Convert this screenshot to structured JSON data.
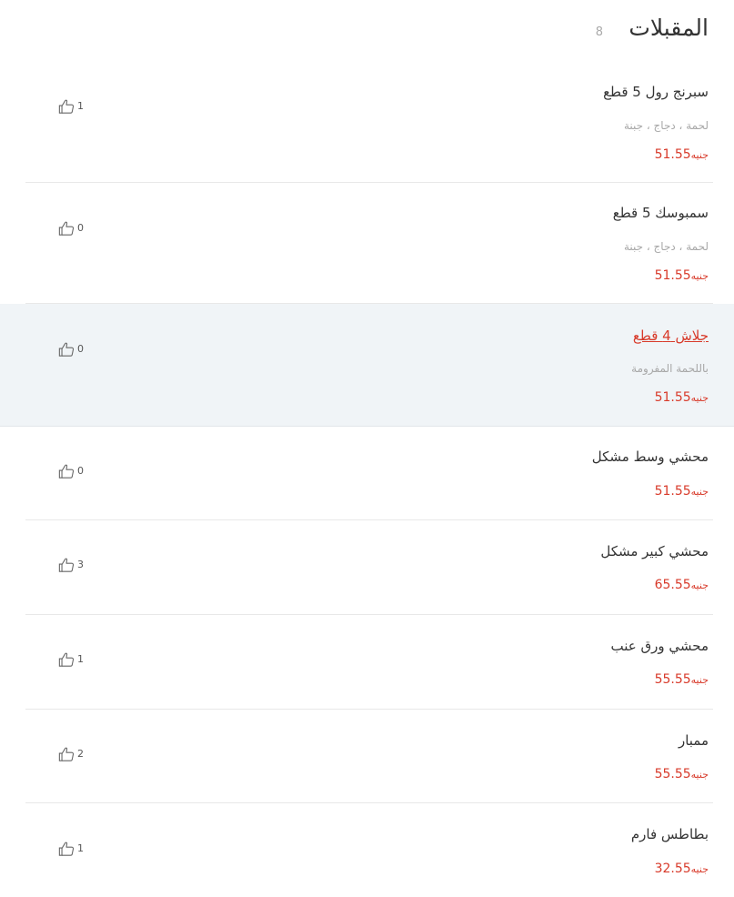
{
  "section": {
    "title": "المقبلات",
    "count": "8"
  },
  "items": [
    {
      "name": "سبرنج رول 5 قطع",
      "description": "لحمة ، دجاج ، جبنة",
      "price": "51.55",
      "currency": "جنيه",
      "likes": "1"
    },
    {
      "name": "سمبوسك 5 قطع",
      "description": "لحمة ، دجاج ، جبنة",
      "price": "51.55",
      "currency": "جنيه",
      "likes": "0"
    },
    {
      "name": "جلاش 4 قطع",
      "description": "باللحمة المفرومة",
      "price": "51.55",
      "currency": "جنيه",
      "likes": "0"
    },
    {
      "name": "محشي وسط مشكل",
      "description": "",
      "price": "51.55",
      "currency": "جنيه",
      "likes": "0"
    },
    {
      "name": "محشي كبير مشكل",
      "description": "",
      "price": "65.55",
      "currency": "جنيه",
      "likes": "3"
    },
    {
      "name": "محشي ورق عنب",
      "description": "",
      "price": "55.55",
      "currency": "جنيه",
      "likes": "1"
    },
    {
      "name": "ممبار",
      "description": "",
      "price": "55.55",
      "currency": "جنيه",
      "likes": "2"
    },
    {
      "name": "بطاطس فارم",
      "description": "",
      "price": "32.55",
      "currency": "جنيه",
      "likes": "1"
    }
  ],
  "icons": {
    "like": "thumbs-up-icon"
  },
  "colors": {
    "price": "#d83a2a",
    "highlight_bg": "#f0f4f7",
    "title": "#333333",
    "muted": "#a8a8a8"
  }
}
